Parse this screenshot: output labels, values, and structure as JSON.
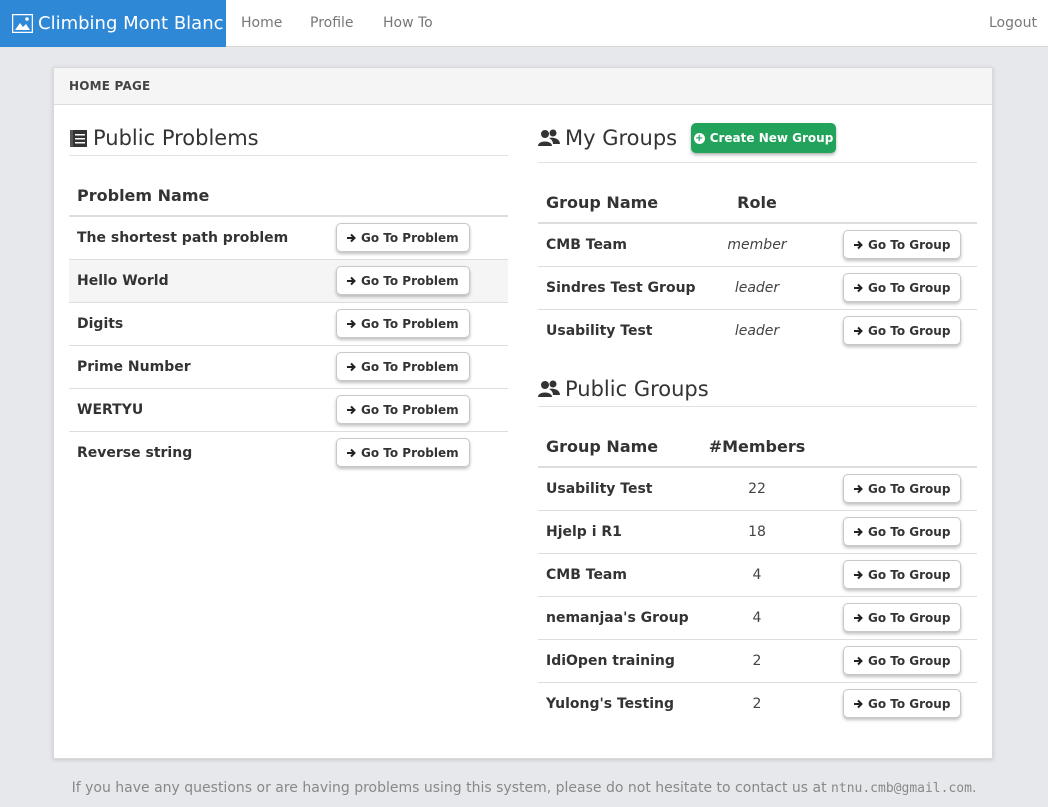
{
  "navbar": {
    "brand": "Climbing Mont Blanc",
    "links": {
      "home": "Home",
      "profile": "Profile",
      "howto": "How To"
    },
    "logout": "Logout"
  },
  "panel": {
    "heading": "HOME PAGE"
  },
  "public_problems": {
    "title": "Public Problems",
    "column": "Problem Name",
    "button_label": "Go To Problem",
    "rows": [
      "The shortest path problem",
      "Hello World",
      "Digits",
      "Prime Number",
      "WERTYU",
      "Reverse string"
    ]
  },
  "my_groups": {
    "title": "My Groups",
    "create_button": "Create New Group",
    "columns": {
      "name": "Group Name",
      "role": "Role"
    },
    "button_label": "Go To Group",
    "rows": [
      {
        "name": "CMB Team",
        "role": "member"
      },
      {
        "name": "Sindres Test Group",
        "role": "leader"
      },
      {
        "name": "Usability Test",
        "role": "leader"
      }
    ]
  },
  "public_groups": {
    "title": "Public Groups",
    "columns": {
      "name": "Group Name",
      "members": "#Members"
    },
    "button_label": "Go To Group",
    "rows": [
      {
        "name": "Usability Test",
        "members": "22"
      },
      {
        "name": "Hjelp i R1",
        "members": "18"
      },
      {
        "name": "CMB Team",
        "members": "4"
      },
      {
        "name": "nemanjaa's Group",
        "members": "4"
      },
      {
        "name": "IdiOpen training",
        "members": "2"
      },
      {
        "name": "Yulong's Testing",
        "members": "2"
      }
    ]
  },
  "footer": {
    "text": "If you have any questions or are having problems using this system, please do not hesitate to contact us at ",
    "email": "ntnu.cmb@gmail.com",
    "end": "."
  },
  "colors": {
    "brand": "#2f88d6",
    "create": "#21a35c"
  }
}
